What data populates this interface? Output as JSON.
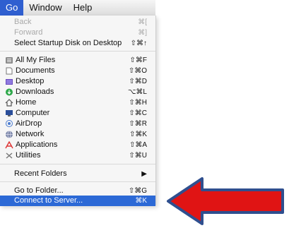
{
  "menubar": {
    "items": [
      "Go",
      "Window",
      "Help"
    ]
  },
  "menu": {
    "items": [
      {
        "label": "Back",
        "shortcut": "⌘[",
        "disabled": true
      },
      {
        "label": "Forward",
        "shortcut": "⌘]",
        "disabled": true
      },
      {
        "label": "Select Startup Disk on Desktop",
        "shortcut": "⇧⌘↑"
      },
      {
        "label": "All My Files",
        "shortcut": "⇧⌘F",
        "icon": "all-my-files-icon"
      },
      {
        "label": "Documents",
        "shortcut": "⇧⌘O",
        "icon": "documents-icon"
      },
      {
        "label": "Desktop",
        "shortcut": "⇧⌘D",
        "icon": "desktop-icon"
      },
      {
        "label": "Downloads",
        "shortcut": "⌥⌘L",
        "icon": "downloads-icon"
      },
      {
        "label": "Home",
        "shortcut": "⇧⌘H",
        "icon": "home-icon"
      },
      {
        "label": "Computer",
        "shortcut": "⇧⌘C",
        "icon": "computer-icon"
      },
      {
        "label": "AirDrop",
        "shortcut": "⇧⌘R",
        "icon": "airdrop-icon"
      },
      {
        "label": "Network",
        "shortcut": "⇧⌘K",
        "icon": "network-icon"
      },
      {
        "label": "Applications",
        "shortcut": "⇧⌘A",
        "icon": "applications-icon"
      },
      {
        "label": "Utilities",
        "shortcut": "⇧⌘U",
        "icon": "utilities-icon"
      },
      {
        "label": "Recent Folders",
        "shortcut": "▶"
      },
      {
        "label": "Go to Folder...",
        "shortcut": "⇧⌘G"
      },
      {
        "label": "Connect to Server...",
        "shortcut": "⌘K",
        "highlighted": true
      }
    ]
  },
  "colors": {
    "highlight": "#2c69d6",
    "arrow": "#e01414",
    "arrow_outline": "#2f4f8f"
  }
}
